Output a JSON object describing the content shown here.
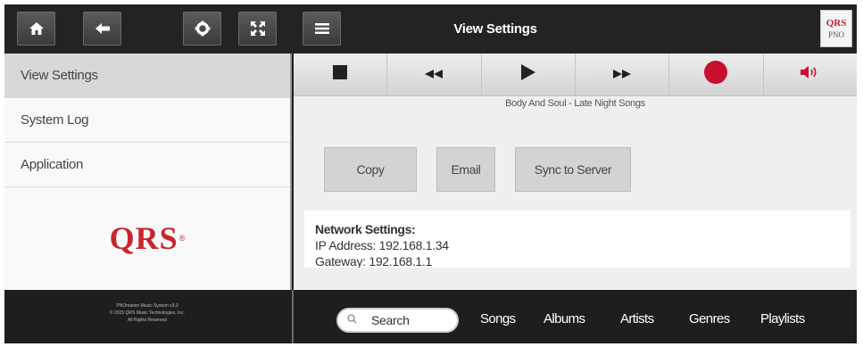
{
  "header": {
    "title": "View Settings",
    "logo_text_top": "QRS",
    "logo_text_bottom": "PNO"
  },
  "sidebar": {
    "items": [
      {
        "label": "View Settings",
        "active": true
      },
      {
        "label": "System Log",
        "active": false
      },
      {
        "label": "Application",
        "active": false
      }
    ],
    "logo_text": "QRS"
  },
  "player": {
    "controls": [
      "stop-icon",
      "rewind-icon",
      "play-icon",
      "fast-forward-icon",
      "record-icon",
      "volume-icon"
    ],
    "now_playing": "Body And Soul - Late Night Songs",
    "record_color": "#c8102e"
  },
  "actions": {
    "copy_label": "Copy",
    "email_label": "Email",
    "sync_label": "Sync to Server"
  },
  "network": {
    "title": "Network Settings:",
    "ip_line": "IP Address: 192.168.1.34",
    "gateway_line": "Gateway: 192.168.1.1"
  },
  "footer": {
    "copyright_lines": [
      "PNOmation Music System v3.0",
      "© 2015 QRS Music Technologies, Inc.",
      "All Rights Reserved"
    ],
    "search_label": "Search",
    "nav": [
      "Songs",
      "Albums",
      "Artists",
      "Genres",
      "Playlists"
    ]
  },
  "colors": {
    "brand_red": "#c8252d",
    "bar_bg": "#232323"
  }
}
